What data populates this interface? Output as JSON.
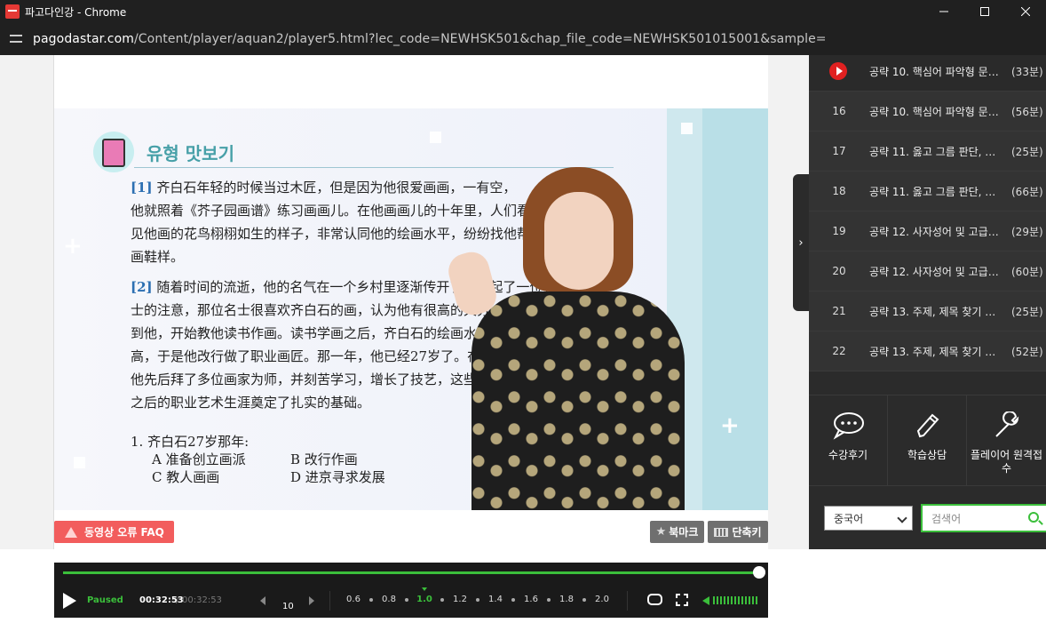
{
  "window": {
    "title": "파고다인강 - Chrome",
    "url_host": "pagodastar.com",
    "url_path": "/Content/player/aquan2/player5.html?lec_code=NEWHSK501&chap_file_code=NEWHSK501015001&sample="
  },
  "video": {
    "board_title": "유형 맛보기",
    "para1": [
      "齐白石年轻的时候当过木匠，但是因为他很爱画画，一有空，",
      "他就照着《芥子园画谱》练习画画儿。在他画画儿的十年里，人们看",
      "见他画的花鸟栩栩如生的样子，非常认同他的绘画水平，纷纷找他帮忙",
      "画鞋样。"
    ],
    "para1_num": "[1]",
    "para2": [
      "随着时间的流逝，他的名气在一个乡村里逐渐传开了，引起了一位名",
      "士的注意，那位名士很喜欢齐白石的画，认为他有很高的天分，就找",
      "到他，开始教他读书作画。读书学画之后，齐白石的绘画水平越来越",
      "高，于是他改行做了职业画匠。那一年，他已经27岁了。在之后的日子里，",
      "他先后拜了多位画家为师，并刻苦学习，增长了技艺，这些为他",
      "之后的职业艺术生涯奠定了扎实的基础。"
    ],
    "para2_num": "[2]",
    "question": "1.  齐白石27岁那年:",
    "opt_a": "A  准备创立画派",
    "opt_b": "B  改行作画",
    "opt_c": "C  教人画画",
    "opt_d": "D  进京寻求发展"
  },
  "buttons": {
    "faq": "동영상 오류 FAQ",
    "bookmark": "북마크",
    "shortcut": "단축키"
  },
  "player": {
    "status": "Paused",
    "time_current": "00:32:53",
    "time_sep": "/",
    "time_total": "00:32:53",
    "skip": "10",
    "progress": 1.0,
    "speeds": [
      "0.6",
      "0.8",
      "1.0",
      "1.2",
      "1.4",
      "1.6",
      "1.8",
      "2.0"
    ],
    "active_speed": "1.0",
    "accent": "#3bbf3b"
  },
  "lectures": [
    {
      "num": "",
      "title": "공략 10. 핵심어 파악형 문…",
      "dur": "(33분)",
      "current": true
    },
    {
      "num": "16",
      "title": "공략 10. 핵심어 파악형 문…",
      "dur": "(56분)"
    },
    {
      "num": "17",
      "title": "공략 11. 옳고 그름 판단, …",
      "dur": "(25분)"
    },
    {
      "num": "18",
      "title": "공략 11. 옳고 그름 판단, …",
      "dur": "(66분)"
    },
    {
      "num": "19",
      "title": "공략 12. 사자성어 및 고급…",
      "dur": "(29분)"
    },
    {
      "num": "20",
      "title": "공략 12. 사자성어 및 고급…",
      "dur": "(60분)"
    },
    {
      "num": "21",
      "title": "공략 13. 주제, 제목 찾기 …",
      "dur": "(25분)"
    },
    {
      "num": "22",
      "title": "공략 13. 주제, 제목 찾기 …",
      "dur": "(52분)"
    }
  ],
  "actions": {
    "review": "수강후기",
    "consult": "학습상담",
    "report": "플레이어 원격접수"
  },
  "filter": {
    "language": "중국어",
    "search_placeholder": "검색어"
  }
}
